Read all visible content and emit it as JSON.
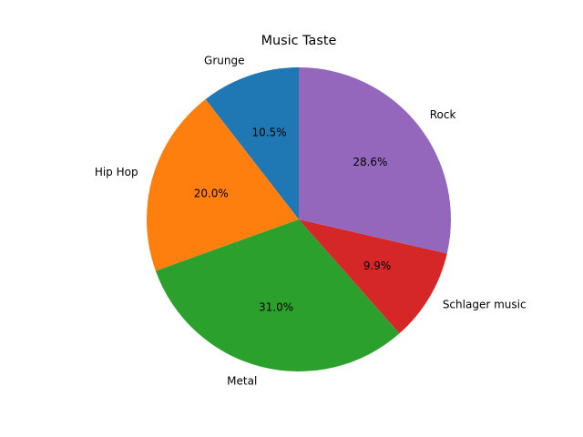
{
  "chart_data": {
    "type": "pie",
    "title": "Music Taste",
    "slices": [
      {
        "label": "Grunge",
        "value": 10.5,
        "pct_label": "10.5%",
        "color": "#1f77b4"
      },
      {
        "label": "Hip Hop",
        "value": 20.0,
        "pct_label": "20.0%",
        "color": "#ff7f0e"
      },
      {
        "label": "Metal",
        "value": 31.0,
        "pct_label": "31.0%",
        "color": "#2ca02c"
      },
      {
        "label": "Schlager music",
        "value": 9.9,
        "pct_label": "9.9%",
        "color": "#d62728"
      },
      {
        "label": "Rock",
        "value": 28.6,
        "pct_label": "28.6%",
        "color": "#9467bd"
      }
    ],
    "start_angle_deg": 90,
    "direction": "counterclockwise"
  }
}
